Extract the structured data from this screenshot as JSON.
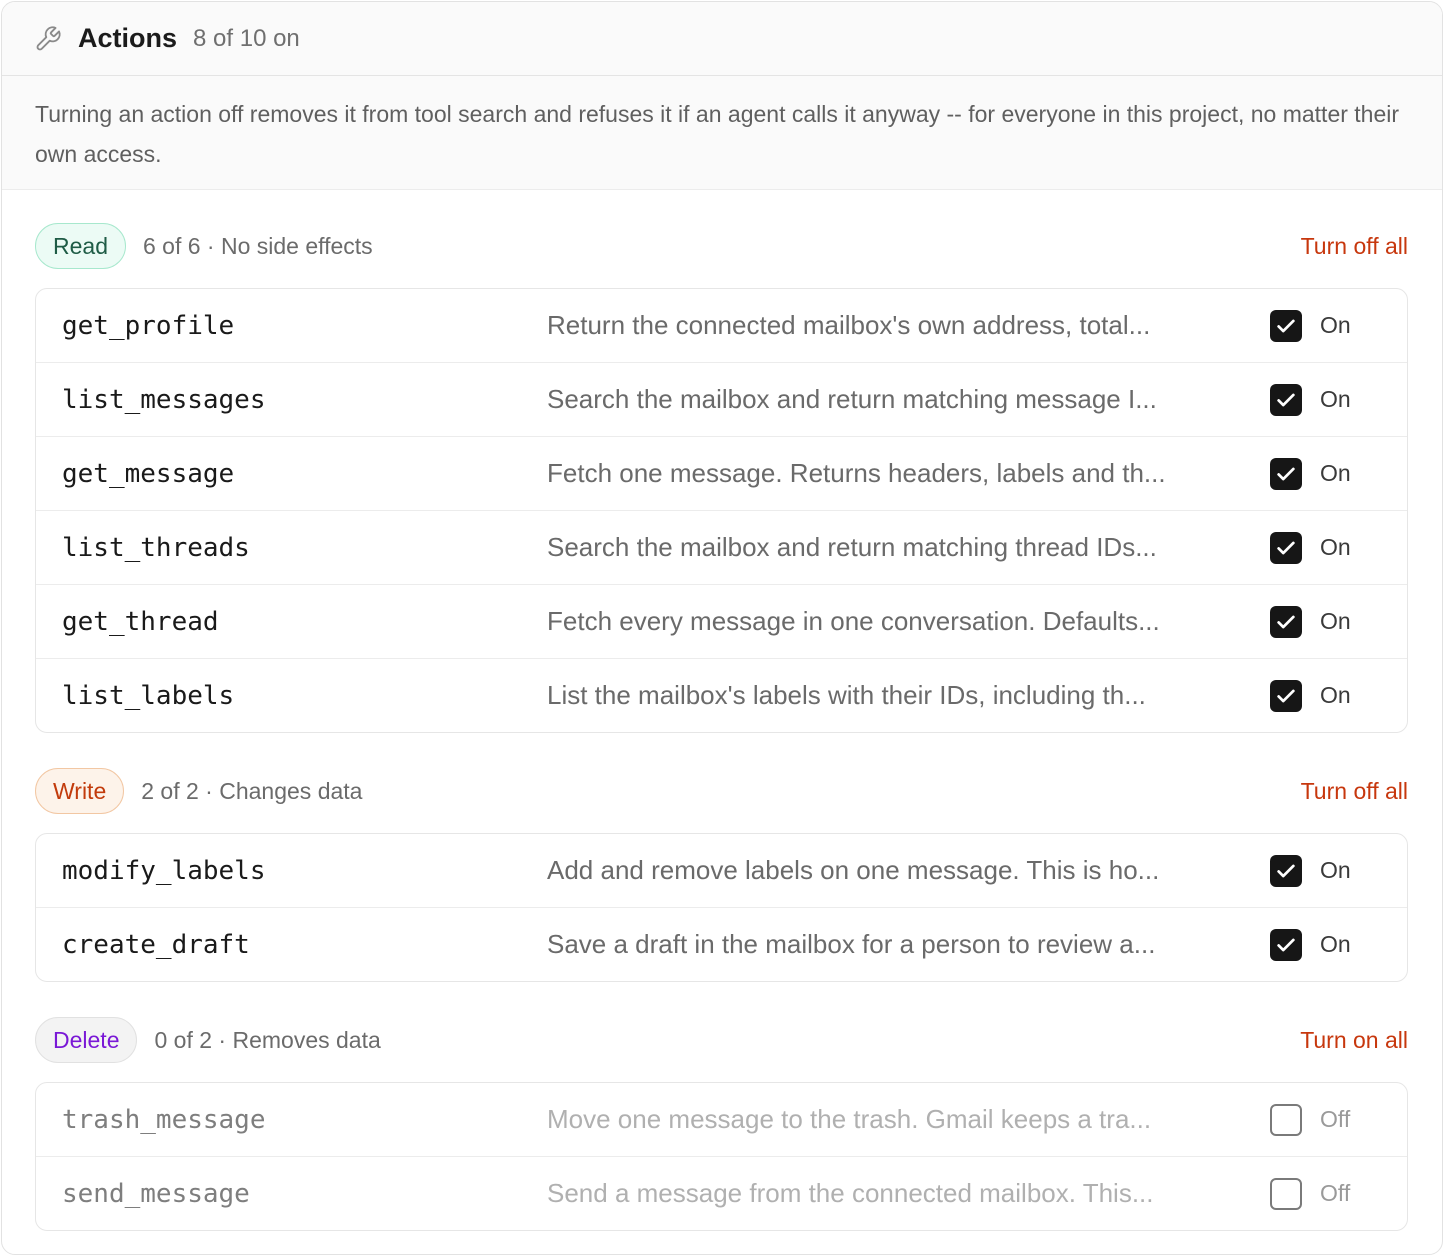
{
  "header": {
    "title": "Actions",
    "count": "8 of 10 on",
    "icon": "wrench-icon"
  },
  "notice": "Turning an action off removes it from tool search and refuses it if an agent calls it anyway -- for everyone in this project, no matter their own access.",
  "groups": [
    {
      "badge": "Read",
      "meta": "6 of 6 · No side effects",
      "action": "Turn off all",
      "items": [
        {
          "name": "get_profile",
          "desc": "Return the connected mailbox's own address, total...",
          "state": "On",
          "checked": true
        },
        {
          "name": "list_messages",
          "desc": "Search the mailbox and return matching message I...",
          "state": "On",
          "checked": true
        },
        {
          "name": "get_message",
          "desc": "Fetch one message. Returns headers, labels and th...",
          "state": "On",
          "checked": true
        },
        {
          "name": "list_threads",
          "desc": "Search the mailbox and return matching thread IDs...",
          "state": "On",
          "checked": true
        },
        {
          "name": "get_thread",
          "desc": "Fetch every message in one conversation. Defaults...",
          "state": "On",
          "checked": true
        },
        {
          "name": "list_labels",
          "desc": "List the mailbox's labels with their IDs, including th...",
          "state": "On",
          "checked": true
        }
      ]
    },
    {
      "badge": "Write",
      "meta": "2 of 2 · Changes data",
      "action": "Turn off all",
      "items": [
        {
          "name": "modify_labels",
          "desc": "Add and remove labels on one message. This is ho...",
          "state": "On",
          "checked": true
        },
        {
          "name": "create_draft",
          "desc": "Save a draft in the mailbox for a person to review a...",
          "state": "On",
          "checked": true
        }
      ]
    },
    {
      "badge": "Delete",
      "meta": "0 of 2 · Removes data",
      "action": "Turn on all",
      "items": [
        {
          "name": "trash_message",
          "desc": "Move one message to the trash. Gmail keeps a tra...",
          "state": "Off",
          "checked": false
        },
        {
          "name": "send_message",
          "desc": "Send a message from the connected mailbox. This...",
          "state": "Off",
          "checked": false
        }
      ]
    }
  ],
  "colors": {
    "accent_action": "#c7370d",
    "read": "#1f5c46",
    "write": "#c23b0c",
    "delete": "#7a18d6"
  }
}
